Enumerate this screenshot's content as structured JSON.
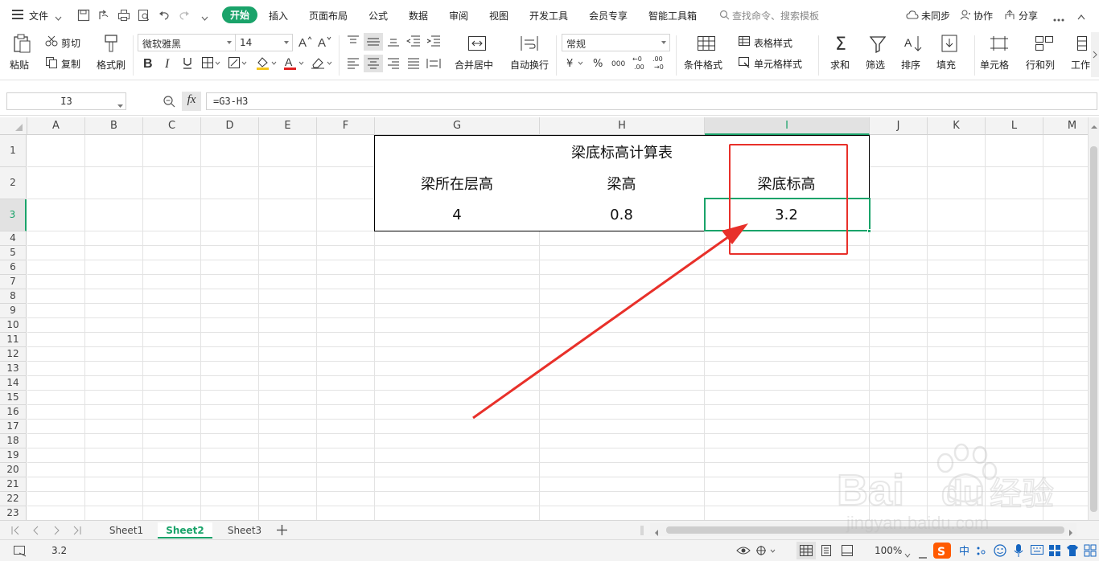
{
  "menubar": {
    "file_label": "文件",
    "items": [
      "开始",
      "插入",
      "页面布局",
      "公式",
      "数据",
      "审阅",
      "视图",
      "开发工具",
      "会员专享",
      "智能工具箱"
    ],
    "active_item": "开始",
    "search_placeholder": "查找命令、搜索模板",
    "sync_label": "未同步",
    "collab_label": "协作",
    "share_label": "分享"
  },
  "ribbon": {
    "paste": "粘贴",
    "cut": "剪切",
    "copy": "复制",
    "format_painter": "格式刷",
    "font_name": "微软雅黑",
    "font_size": "14",
    "number_format": "常规",
    "merge_center": "合并居中",
    "wrap_text": "自动换行",
    "conditional_format": "条件格式",
    "table_style": "表格样式",
    "cell_style": "单元格样式",
    "sum": "求和",
    "filter": "筛选",
    "sort": "排序",
    "fill": "填充",
    "cell": "单元格",
    "row_col": "行和列",
    "worksheet": "工作"
  },
  "formula_bar": {
    "name_box": "I3",
    "fx": "fx",
    "formula": "=G3-H3"
  },
  "grid": {
    "columns": [
      "A",
      "B",
      "C",
      "D",
      "E",
      "F",
      "G",
      "H",
      "I",
      "J",
      "K",
      "L",
      "M"
    ],
    "rows": [
      "1",
      "2",
      "3",
      "4",
      "5",
      "6",
      "7",
      "8",
      "9",
      "10",
      "11",
      "12",
      "13",
      "14",
      "15",
      "16",
      "17",
      "18",
      "19",
      "20",
      "21",
      "22",
      "23"
    ],
    "selected_column": "I",
    "selected_row": "3"
  },
  "table": {
    "title": "梁底标高计算表",
    "headers": [
      "梁所在层高",
      "梁高",
      "梁底标高"
    ],
    "values": [
      "4",
      "0.8",
      "3.2"
    ]
  },
  "sheets": [
    "Sheet1",
    "Sheet2",
    "Sheet3"
  ],
  "active_sheet": "Sheet2",
  "status": {
    "cell_value": "3.2",
    "zoom": "100%"
  },
  "colors": {
    "accent": "#1aa36a",
    "annotation": "#e8302a"
  },
  "watermark": {
    "brand": "Bai",
    "brand2": "du",
    "cn": "经验",
    "url": "jingyan.baidu.com"
  }
}
